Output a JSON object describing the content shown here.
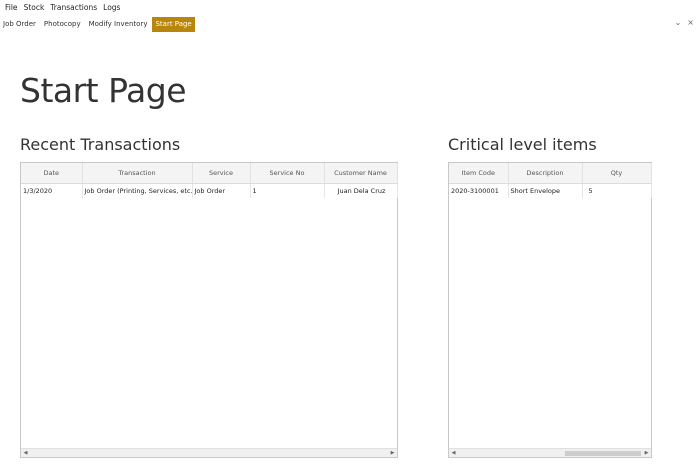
{
  "menu": {
    "items": [
      {
        "label": "File"
      },
      {
        "label": "Stock"
      },
      {
        "label": "Transactions"
      },
      {
        "label": "Logs"
      }
    ]
  },
  "tabs": [
    {
      "label": "Job Order",
      "active": false
    },
    {
      "label": "Photocopy",
      "active": false
    },
    {
      "label": "Modify Inventory",
      "active": false
    },
    {
      "label": "Start Page",
      "active": true
    }
  ],
  "window_controls": {
    "minimize": "⌄",
    "close": "×"
  },
  "page": {
    "title": "Start Page"
  },
  "recent": {
    "title": "Recent Transactions",
    "columns": [
      "Date",
      "Transaction",
      "Service",
      "Service No",
      "Customer Name"
    ],
    "rows": [
      [
        "1/3/2020",
        "Job Order (Printing, Services, etc.)",
        "Job Order",
        "1",
        "Juan Dela Cruz"
      ]
    ]
  },
  "critical": {
    "title": "Critical level items",
    "columns": [
      "Item Code",
      "Description",
      "Qty"
    ],
    "rows": [
      [
        "2020-3100001",
        "Short Envelope",
        "5"
      ]
    ]
  },
  "colors": {
    "active_tab": "#b8860b",
    "header_bg": "#f4f4f4",
    "border": "#c8c8c8"
  }
}
